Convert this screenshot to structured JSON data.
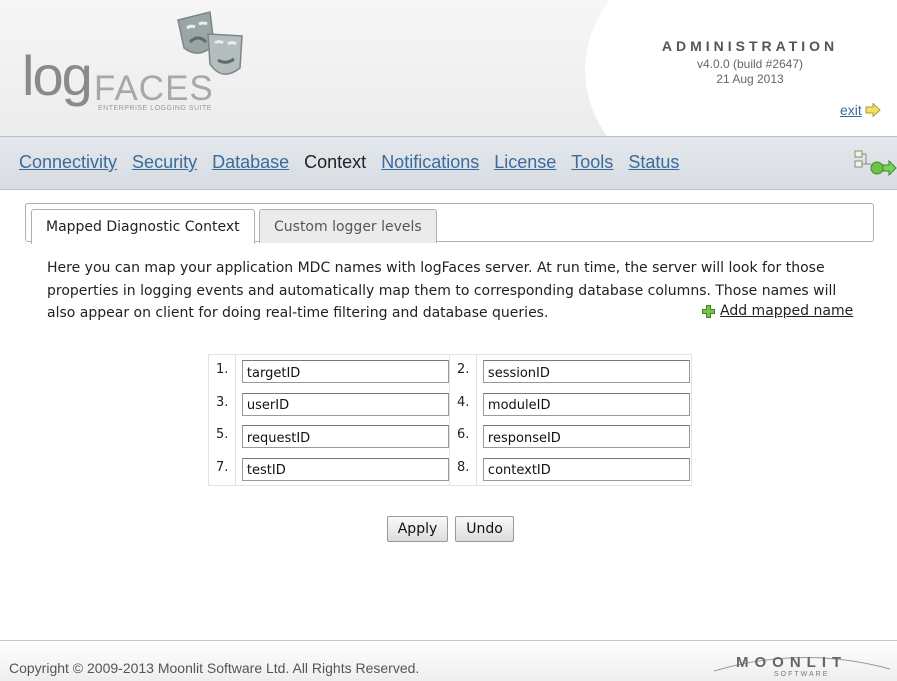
{
  "brand": {
    "logo_log": "log",
    "logo_faces": "FACES",
    "logo_tagline": "ENTERPRISE LOGGING SUITE",
    "logo_icon": "theater-masks-icon"
  },
  "admin": {
    "title": "ADMINISTRATION",
    "version": "v4.0.0 (build #2647)",
    "date": "21 Aug 2013",
    "exit_label": "exit",
    "exit_icon": "arrow-right-icon"
  },
  "nav": {
    "items": [
      {
        "label": "Connectivity",
        "active": false
      },
      {
        "label": "Security",
        "active": false
      },
      {
        "label": "Database",
        "active": false
      },
      {
        "label": "Context",
        "active": true
      },
      {
        "label": "Notifications",
        "active": false
      },
      {
        "label": "License",
        "active": false
      },
      {
        "label": "Tools",
        "active": false
      },
      {
        "label": "Status",
        "active": false
      }
    ],
    "right_icon": "workflow-icon"
  },
  "tabs": [
    {
      "label": "Mapped Diagnostic Context",
      "active": true
    },
    {
      "label": "Custom logger levels",
      "active": false
    }
  ],
  "description": "Here you can map your application MDC names with logFaces server. At run time, the server will look for those properties in logging events and automatically map them to corresponding database columns. Those names will also appear on client for doing real-time filtering and database queries.",
  "add_mapped_name": {
    "label": "Add mapped name",
    "icon": "plus-icon"
  },
  "mdc_names": [
    {
      "num": "1.",
      "value": "targetID"
    },
    {
      "num": "2.",
      "value": "sessionID"
    },
    {
      "num": "3.",
      "value": "userID"
    },
    {
      "num": "4.",
      "value": "moduleID"
    },
    {
      "num": "5.",
      "value": "requestID"
    },
    {
      "num": "6.",
      "value": "responseID"
    },
    {
      "num": "7.",
      "value": "testID"
    },
    {
      "num": "8.",
      "value": "contextID"
    }
  ],
  "buttons": {
    "apply": "Apply",
    "undo": "Undo"
  },
  "footer": {
    "copyright": "Copyright © 2009-2013 Moonlit Software Ltd. All Rights Reserved.",
    "company_name": "MOONLIT",
    "company_sub": "SOFTWARE"
  },
  "colors": {
    "link": "#3b6b9c",
    "nav_bg": "#dde2e7",
    "plus_green": "#5aa02c"
  }
}
